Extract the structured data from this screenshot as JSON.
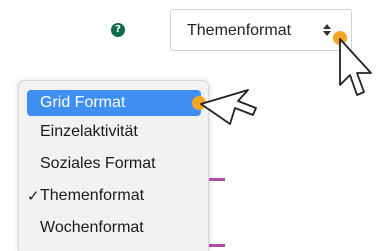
{
  "help": {
    "icon": "question-circle-icon",
    "glyph": "?",
    "color": "#0f6a4a"
  },
  "select": {
    "selected_value": "Themenformat",
    "caret_icon": "up-down-caret-icon"
  },
  "menu": {
    "items": [
      {
        "label": "Grid Format",
        "highlighted": true,
        "checked": false
      },
      {
        "label": "Einzelaktivität",
        "highlighted": false,
        "checked": false
      },
      {
        "label": "Soziales Format",
        "highlighted": false,
        "checked": false
      },
      {
        "label": "Themenformat",
        "highlighted": false,
        "checked": true,
        "check_glyph": "✓"
      },
      {
        "label": "Wochenformat",
        "highlighted": false,
        "checked": false
      }
    ],
    "highlight_color": "#3e8ff1"
  },
  "cursors": {
    "icon": "mouse-pointer-icon",
    "click_indicator_color": "#f5a623"
  },
  "accent": {
    "side_mark_color": "#b04ca6"
  }
}
